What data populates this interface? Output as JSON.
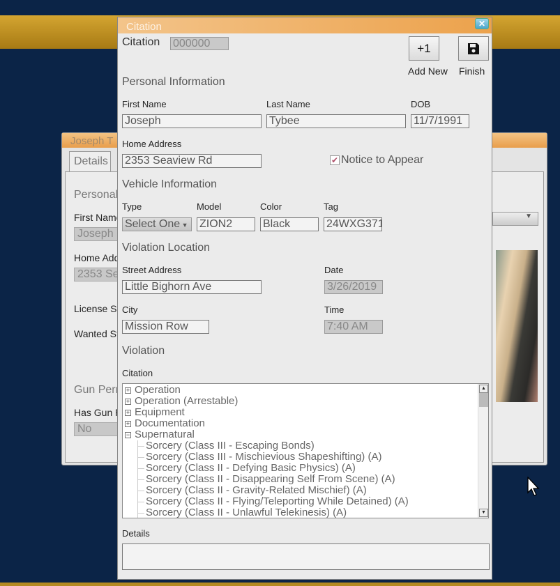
{
  "background_window": {
    "title": "Joseph T",
    "tab": "Details",
    "section_personal": "Personal",
    "first_name_label": "First Name",
    "first_name_value": "Joseph",
    "home_address_label": "Home Add",
    "home_address_value": "2353 Se",
    "license_label": "License St",
    "wanted_label": "Wanted St",
    "gun_section": "Gun Perm",
    "has_gun_label": "Has Gun P",
    "has_gun_value": "No"
  },
  "dialog": {
    "title": "Citation",
    "close_icon": "close-x",
    "citation_label": "Citation",
    "citation_number": "000000",
    "add_new": {
      "icon_text": "+1",
      "label": "Add New"
    },
    "finish": {
      "icon": "floppy-disk-icon",
      "label": "Finish"
    },
    "personal_info": {
      "heading": "Personal Information",
      "first_name_label": "First Name",
      "first_name": "Joseph",
      "last_name_label": "Last Name",
      "last_name": "Tybee",
      "dob_label": "DOB",
      "dob": "11/7/1991",
      "home_address_label": "Home Address",
      "home_address": "2353 Seaview Rd",
      "notice_to_appear_label": "Notice to Appear",
      "notice_to_appear_checked": true
    },
    "vehicle": {
      "heading": "Vehicle Information",
      "type_label": "Type",
      "type_value": "Select One",
      "model_label": "Model",
      "model": "ZION2",
      "color_label": "Color",
      "color": "Black",
      "tag_label": "Tag",
      "tag": "24WXG371"
    },
    "location": {
      "heading": "Violation Location",
      "street_label": "Street Address",
      "street": "Little Bighorn Ave",
      "date_label": "Date",
      "date": "3/26/2019",
      "city_label": "City",
      "city": "Mission Row",
      "time_label": "Time",
      "time": "7:40 AM"
    },
    "violation": {
      "heading": "Violation",
      "citation_label": "Citation",
      "tree": [
        {
          "label": "Operation",
          "expanded": false
        },
        {
          "label": "Operation (Arrestable)",
          "expanded": false
        },
        {
          "label": "Equipment",
          "expanded": false
        },
        {
          "label": "Documentation",
          "expanded": false
        },
        {
          "label": "Supernatural",
          "expanded": true,
          "children": [
            "Sorcery (Class III - Escaping Bonds)",
            "Sorcery (Class III - Mischievious Shapeshifting) (A)",
            "Sorcery (Class II - Defying Basic Physics) (A)",
            "Sorcery (Class II - Disappearing Self From Scene) (A)",
            "Sorcery (Class II - Gravity-Related Mischief) (A)",
            "Sorcery (Class II - Flying/Teleporting While Detained) (A)",
            "Sorcery (Class II - Unlawful Telekinesis) (A)"
          ]
        }
      ]
    },
    "details_label": "Details",
    "details_value": ""
  }
}
